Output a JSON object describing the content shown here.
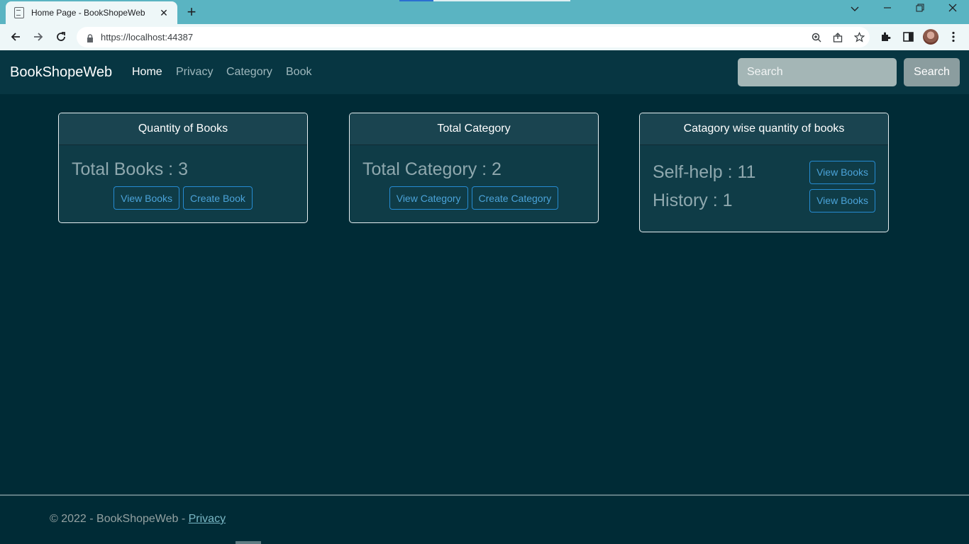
{
  "browser": {
    "tab_title": "Home Page - BookShopeWeb",
    "tab_close": "✕",
    "new_tab": "+",
    "url": "https://localhost:44387"
  },
  "navbar": {
    "brand": "BookShopeWeb",
    "links": [
      "Home",
      "Privacy",
      "Category",
      "Book"
    ],
    "search_placeholder": "Search",
    "search_button": "Search"
  },
  "cards": {
    "books": {
      "header": "Quantity of Books",
      "stat": "Total Books : 3",
      "view_button": "View Books",
      "create_button": "Create Book"
    },
    "category": {
      "header": "Total Category",
      "stat": "Total Category : 2",
      "view_button": "View Category",
      "create_button": "Create Category"
    },
    "categorywise": {
      "header": "Catagory wise quantity of books",
      "rows": [
        {
          "label": "Self-help : 11",
          "button": "View Books"
        },
        {
          "label": "History : 1",
          "button": "View Books"
        }
      ]
    }
  },
  "footer": {
    "text": "© 2022 - BookShopeWeb - ",
    "link": "Privacy"
  },
  "colors": {
    "page_bg": "#002b36",
    "navbar_bg": "#073642",
    "accent": "#268bd2",
    "tabbar": "#5ab4c2"
  }
}
